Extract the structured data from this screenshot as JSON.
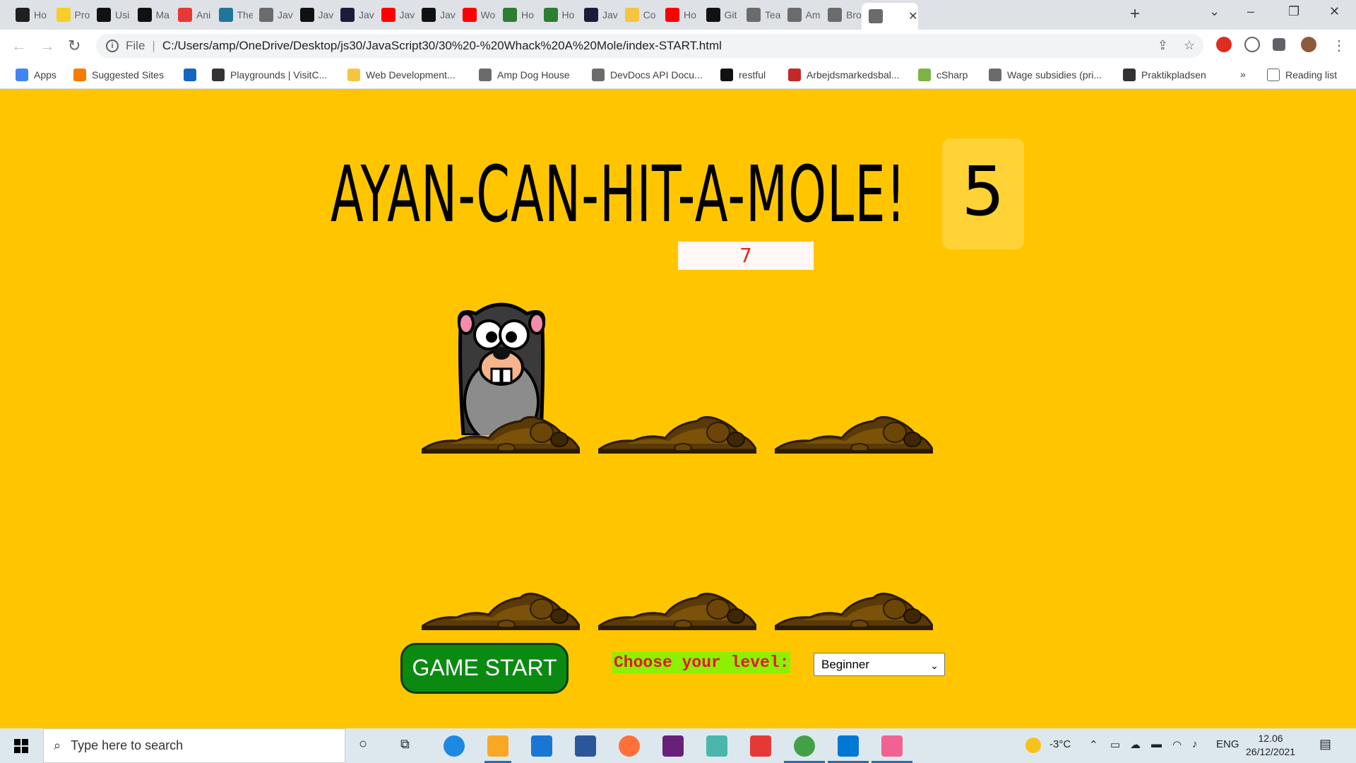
{
  "browser": {
    "tabs": [
      {
        "label": "Ho",
        "color": "#1f1f1f"
      },
      {
        "label": "Pro",
        "color": "#f6d028"
      },
      {
        "label": "Usi",
        "color": "#111111"
      },
      {
        "label": "Ma",
        "color": "#111111"
      },
      {
        "label": "Ani",
        "color": "#e53935"
      },
      {
        "label": "The",
        "color": "#21759b"
      },
      {
        "label": "Jav",
        "color": "#6b6b6b"
      },
      {
        "label": "Jav",
        "color": "#111111"
      },
      {
        "label": "Jav",
        "color": "#1c1c3a"
      },
      {
        "label": "Jav",
        "color": "#ff0000"
      },
      {
        "label": "Jav",
        "color": "#111111"
      },
      {
        "label": "Wo",
        "color": "#ff0000"
      },
      {
        "label": "Ho",
        "color": "#2e7d32"
      },
      {
        "label": "Ho",
        "color": "#2e7d32"
      },
      {
        "label": "Jav",
        "color": "#1c1c3a"
      },
      {
        "label": "Co",
        "color": "#f5c542"
      },
      {
        "label": "Ho",
        "color": "#ff0000"
      },
      {
        "label": "Git",
        "color": "#111111"
      },
      {
        "label": "Tea",
        "color": "#6b6b6b"
      },
      {
        "label": "Am",
        "color": "#6b6b6b"
      },
      {
        "label": "Bro",
        "color": "#6b6b6b"
      },
      {
        "label": "",
        "color": "#6b6b6b"
      }
    ],
    "address": {
      "scheme_label": "File",
      "url": "C:/Users/amp/OneDrive/Desktop/js30/JavaScript30/30%20-%20Whack%20A%20Mole/index-START.html"
    },
    "bookmarks": [
      {
        "label": "Apps",
        "color": "#4285f4"
      },
      {
        "label": "Suggested Sites",
        "color": "#f57c00"
      },
      {
        "label": "",
        "color": "#1565c0"
      },
      {
        "label": "Playgrounds | VisitC...",
        "color": "#333333"
      },
      {
        "label": "Web Development...",
        "color": "#f5c542"
      },
      {
        "label": "Amp Dog House",
        "color": "#6b6b6b"
      },
      {
        "label": "DevDocs API Docu...",
        "color": "#6b6b6b"
      },
      {
        "label": "restful",
        "color": "#111111"
      },
      {
        "label": "Arbejdsmarkedsbal...",
        "color": "#c62828"
      },
      {
        "label": "cSharp",
        "color": "#7cb342"
      },
      {
        "label": "Wage subsidies (pri...",
        "color": "#6b6b6b"
      },
      {
        "label": "Praktikpladsen",
        "color": "#333333"
      }
    ],
    "more_bookmarks": "»",
    "reading_list": "Reading list"
  },
  "game": {
    "title": "AYAN-CAN-HIT-A-MOLE!",
    "score": "5",
    "timer": "7",
    "start_label": "GAME START",
    "level_label": "Choose your level:",
    "level_selected": "Beginner"
  },
  "colors": {
    "background": "#ffc600",
    "score_box": "#ffd236",
    "start_button": "#0b8a12",
    "level_label_bg": "#8cf000",
    "level_label_text": "#e8142b"
  },
  "taskbar": {
    "search_placeholder": "Type here to search",
    "weather": "-3°C",
    "language": "ENG",
    "time": "12.06",
    "date": "26/12/2021"
  }
}
